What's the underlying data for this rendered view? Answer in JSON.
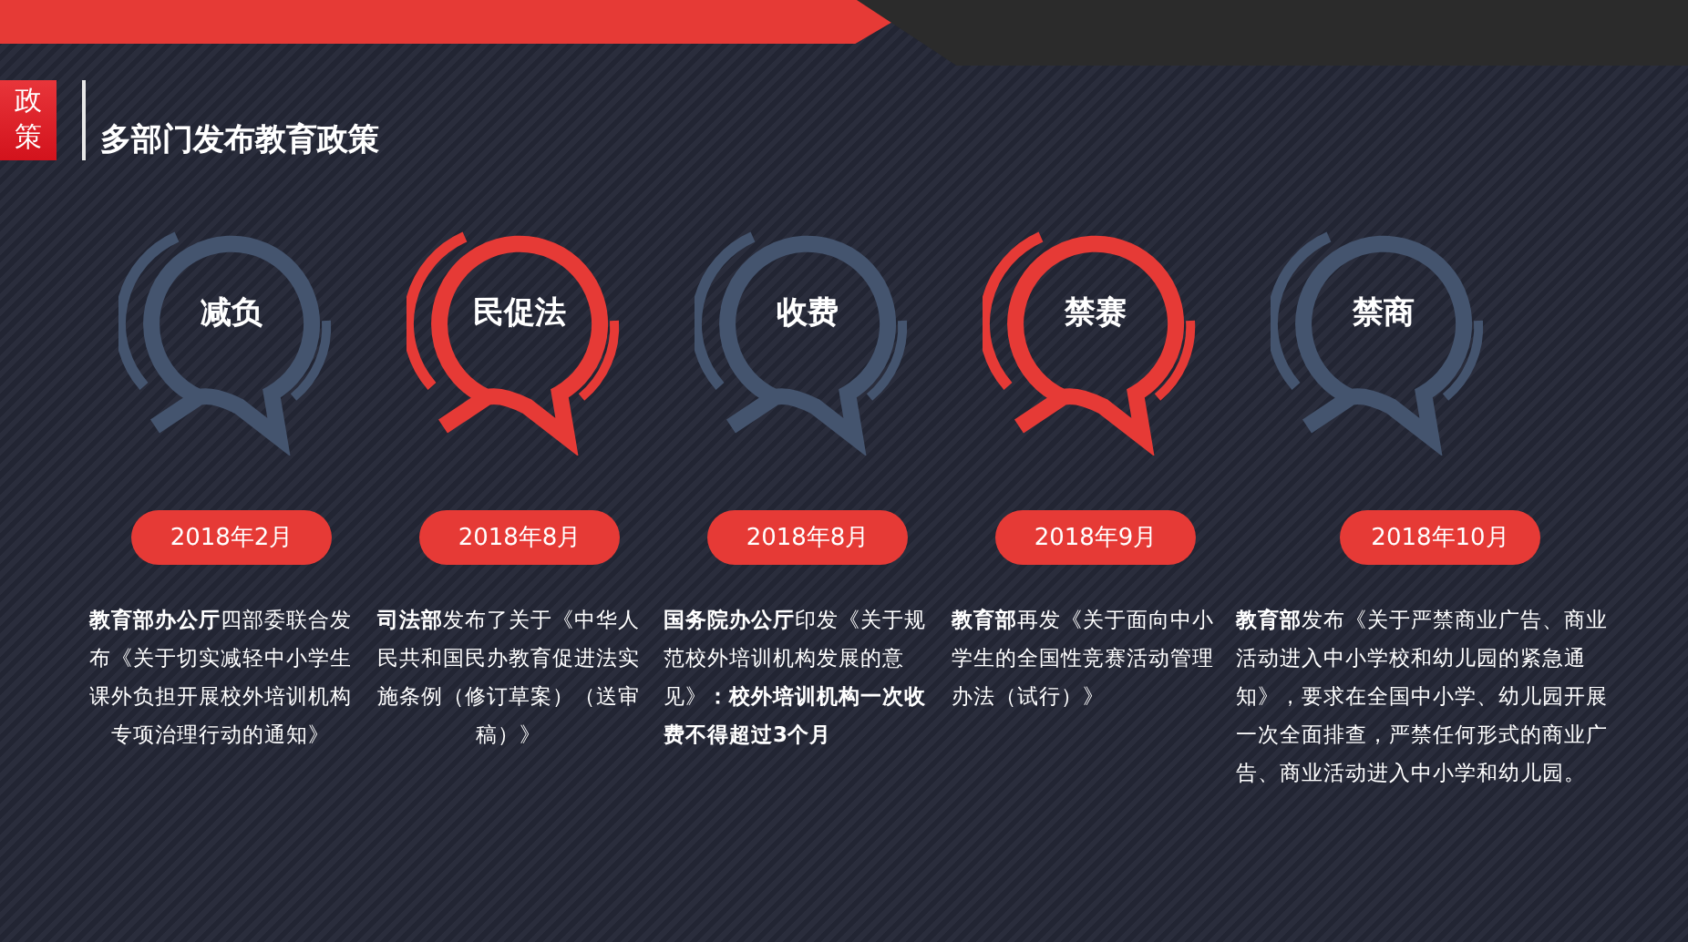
{
  "badge": "政策",
  "title": "多部门发布教育政策",
  "policies": [
    {
      "label": "减负",
      "color": "#44546e",
      "date": "2018年2月",
      "description": "**教育部办公厅**四部委联合发布《关于切实减轻中小学生课外负担开展校外培训机构专项治理行动的通知》"
    },
    {
      "label": "民促法",
      "color": "#e63a36",
      "date": "2018年8月",
      "description": "**司法部**发布了关于《中华人民共和国民办教育促进法实施条例（修订草案）（送审稿）》"
    },
    {
      "label": "收费",
      "color": "#44546e",
      "date": "2018年8月",
      "description": "**国务院办公厅**印发《关于规范校外培训机构发展的意见》**：校外培训机构一次收费不得超过3个月**"
    },
    {
      "label": "禁赛",
      "color": "#e63a36",
      "date": "2018年9月",
      "description": "**教育部**再发《关于面向中小学生的全国性竞赛活动管理办法（试行）》"
    },
    {
      "label": "禁商",
      "color": "#44546e",
      "date": "2018年10月",
      "description": "**教育部**发布《关于严禁商业广告、商业活动进入中小学校和幼儿园的紧急通知》，要求在全国中小学、幼儿园开展一次全面排查，严禁任何形式的商业广告、商业活动进入中小学和幼儿园。"
    }
  ]
}
